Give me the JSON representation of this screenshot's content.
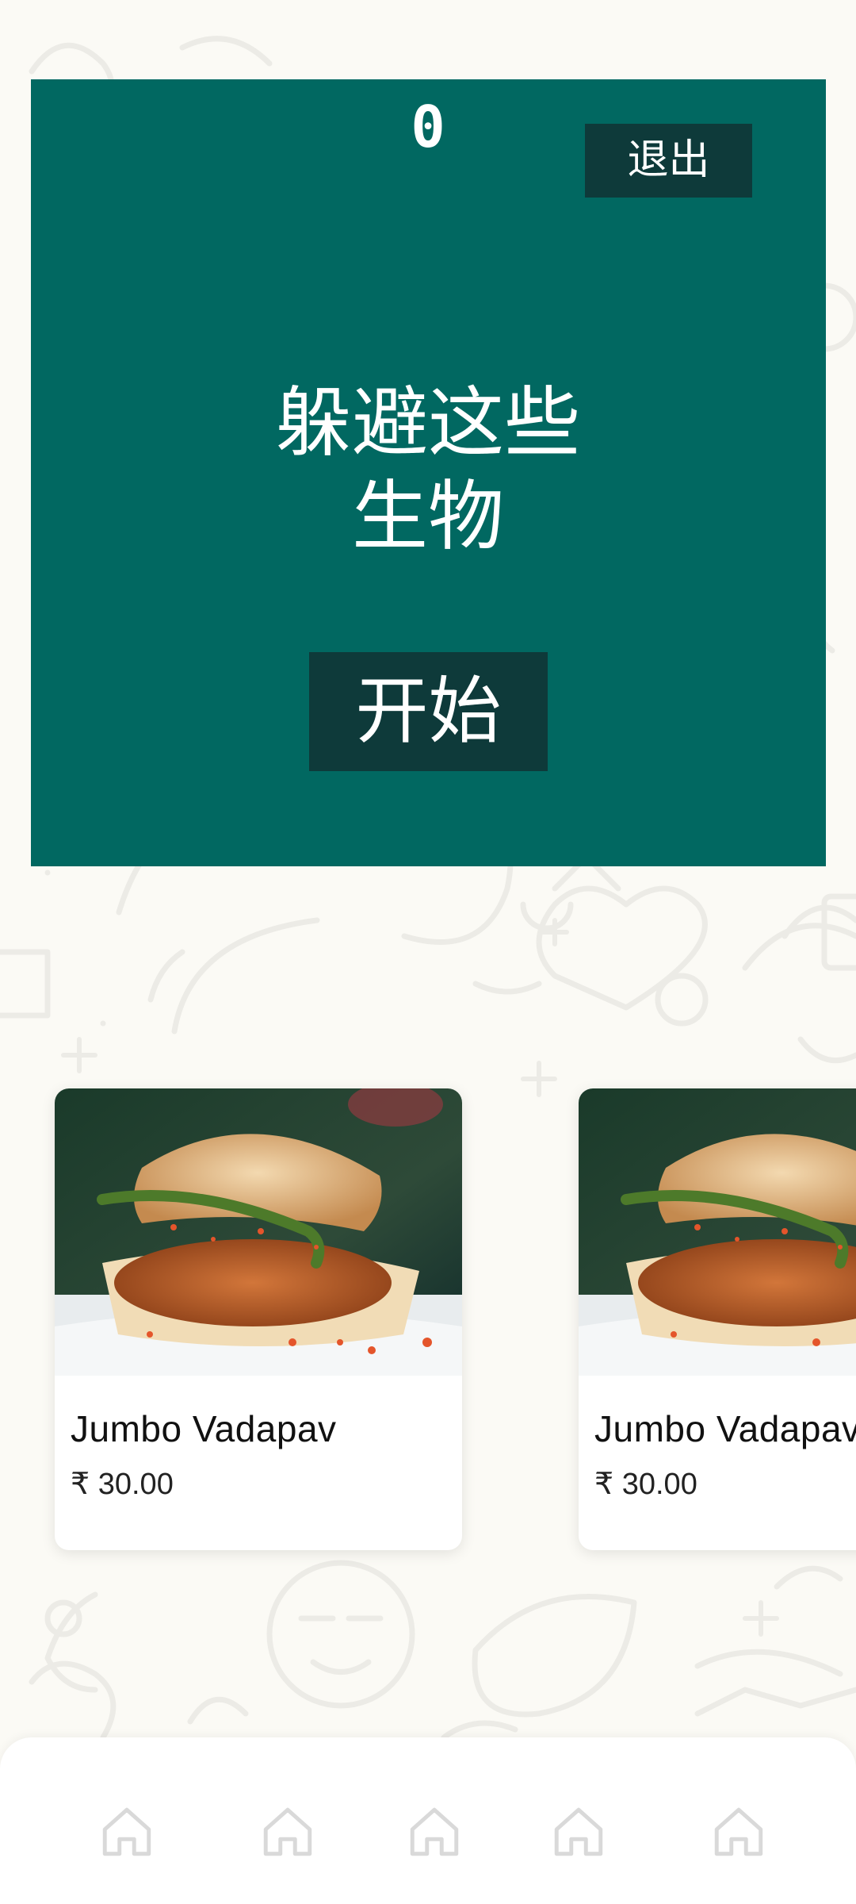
{
  "game": {
    "score": "0",
    "exit_label": "退出",
    "instruction": "躲避这些\n生物",
    "start_label": "开始"
  },
  "products": [
    {
      "name": "Jumbo Vadapav",
      "price": "₹ 30.00"
    },
    {
      "name": "Jumbo Vadapav",
      "price": "₹ 30.00"
    }
  ],
  "bottom_nav": {
    "items": [
      {
        "icon": "home-icon"
      },
      {
        "icon": "home-icon"
      },
      {
        "icon": "home-icon"
      },
      {
        "icon": "home-icon"
      },
      {
        "icon": "home-icon"
      }
    ]
  },
  "colors": {
    "game_panel": "#016861",
    "button": "#0e3a3a",
    "background": "#fbfaf5"
  }
}
